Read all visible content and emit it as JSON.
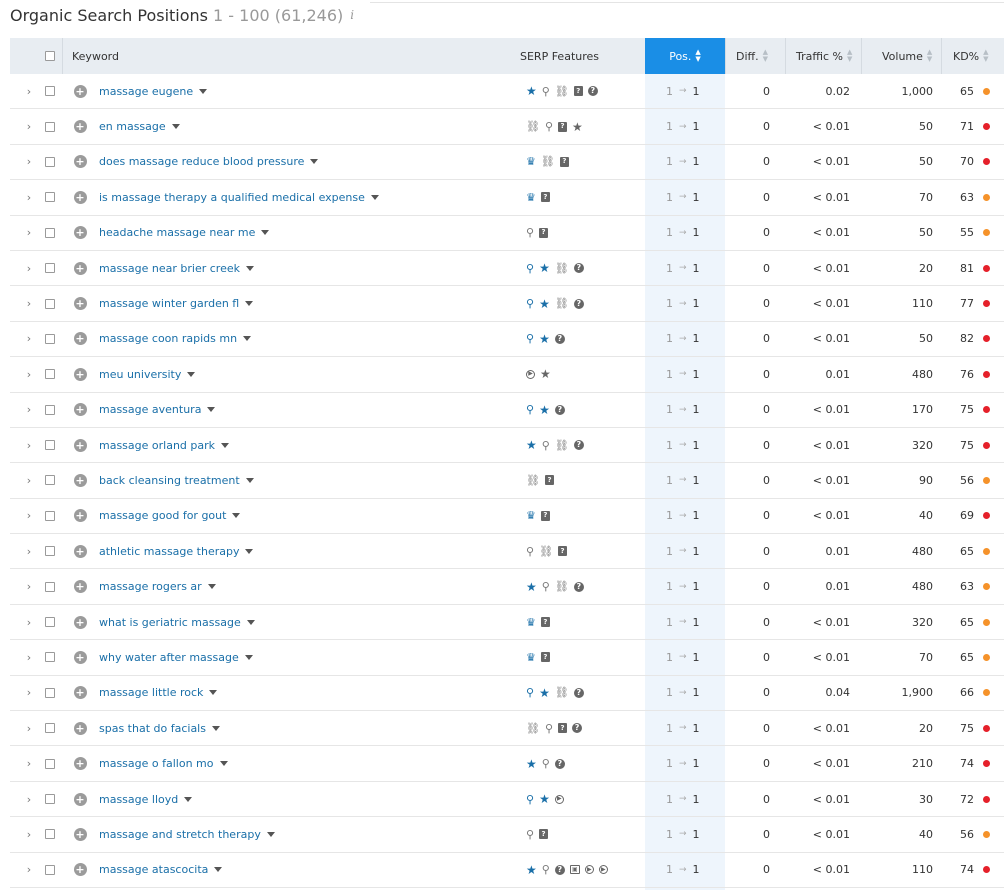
{
  "title": {
    "main": "Organic Search Positions",
    "range": "1 - 100 (61,246)",
    "info": "i"
  },
  "columns": {
    "keyword": "Keyword",
    "serp": "SERP Features",
    "pos": "Pos.",
    "diff": "Diff.",
    "traffic": "Traffic %",
    "volume": "Volume",
    "kd": "KD%"
  },
  "colors": {
    "link": "#1a6fa8",
    "accent": "#1a8ee6",
    "kd_orange": "#f5922a",
    "kd_red": "#e5202a"
  },
  "rows": [
    {
      "keyword": "massage eugene",
      "features": [
        "star",
        "pin",
        "link",
        "box",
        "question"
      ],
      "pos_from": "1",
      "pos_to": "1",
      "diff": "0",
      "traffic": "0.02",
      "volume": "1,000",
      "kd": "65",
      "kd_color": "orange"
    },
    {
      "keyword": "en massage",
      "features": [
        "link",
        "pin",
        "box",
        "gstar"
      ],
      "pos_from": "1",
      "pos_to": "1",
      "diff": "0",
      "traffic": "< 0.01",
      "volume": "50",
      "kd": "71",
      "kd_color": "red"
    },
    {
      "keyword": "does massage reduce blood pressure",
      "features": [
        "crown",
        "link",
        "box"
      ],
      "pos_from": "1",
      "pos_to": "1",
      "diff": "0",
      "traffic": "< 0.01",
      "volume": "50",
      "kd": "70",
      "kd_color": "red"
    },
    {
      "keyword": "is massage therapy a qualified medical expense",
      "features": [
        "crown",
        "box"
      ],
      "pos_from": "1",
      "pos_to": "1",
      "diff": "0",
      "traffic": "< 0.01",
      "volume": "70",
      "kd": "63",
      "kd_color": "orange"
    },
    {
      "keyword": "headache massage near me",
      "features": [
        "pin",
        "box"
      ],
      "pos_from": "1",
      "pos_to": "1",
      "diff": "0",
      "traffic": "< 0.01",
      "volume": "50",
      "kd": "55",
      "kd_color": "orange"
    },
    {
      "keyword": "massage near brier creek",
      "features": [
        "bpin",
        "star",
        "link",
        "question"
      ],
      "pos_from": "1",
      "pos_to": "1",
      "diff": "0",
      "traffic": "< 0.01",
      "volume": "20",
      "kd": "81",
      "kd_color": "red"
    },
    {
      "keyword": "massage winter garden fl",
      "features": [
        "bpin",
        "star",
        "link",
        "question"
      ],
      "pos_from": "1",
      "pos_to": "1",
      "diff": "0",
      "traffic": "< 0.01",
      "volume": "110",
      "kd": "77",
      "kd_color": "red"
    },
    {
      "keyword": "massage coon rapids mn",
      "features": [
        "bpin",
        "star",
        "question"
      ],
      "pos_from": "1",
      "pos_to": "1",
      "diff": "0",
      "traffic": "< 0.01",
      "volume": "50",
      "kd": "82",
      "kd_color": "red"
    },
    {
      "keyword": "meu university",
      "features": [
        "play",
        "gstar"
      ],
      "pos_from": "1",
      "pos_to": "1",
      "diff": "0",
      "traffic": "0.01",
      "volume": "480",
      "kd": "76",
      "kd_color": "red"
    },
    {
      "keyword": "massage aventura",
      "features": [
        "bpin",
        "star",
        "question"
      ],
      "pos_from": "1",
      "pos_to": "1",
      "diff": "0",
      "traffic": "< 0.01",
      "volume": "170",
      "kd": "75",
      "kd_color": "red"
    },
    {
      "keyword": "massage orland park",
      "features": [
        "star",
        "pin",
        "link",
        "question"
      ],
      "pos_from": "1",
      "pos_to": "1",
      "diff": "0",
      "traffic": "< 0.01",
      "volume": "320",
      "kd": "75",
      "kd_color": "red"
    },
    {
      "keyword": "back cleansing treatment",
      "features": [
        "link",
        "box"
      ],
      "pos_from": "1",
      "pos_to": "1",
      "diff": "0",
      "traffic": "< 0.01",
      "volume": "90",
      "kd": "56",
      "kd_color": "orange"
    },
    {
      "keyword": "massage good for gout",
      "features": [
        "crown",
        "box"
      ],
      "pos_from": "1",
      "pos_to": "1",
      "diff": "0",
      "traffic": "< 0.01",
      "volume": "40",
      "kd": "69",
      "kd_color": "red"
    },
    {
      "keyword": "athletic massage therapy",
      "features": [
        "pin",
        "link",
        "box"
      ],
      "pos_from": "1",
      "pos_to": "1",
      "diff": "0",
      "traffic": "0.01",
      "volume": "480",
      "kd": "65",
      "kd_color": "orange"
    },
    {
      "keyword": "massage rogers ar",
      "features": [
        "star",
        "pin",
        "link",
        "question"
      ],
      "pos_from": "1",
      "pos_to": "1",
      "diff": "0",
      "traffic": "0.01",
      "volume": "480",
      "kd": "63",
      "kd_color": "orange"
    },
    {
      "keyword": "what is geriatric massage",
      "features": [
        "crown",
        "box"
      ],
      "pos_from": "1",
      "pos_to": "1",
      "diff": "0",
      "traffic": "< 0.01",
      "volume": "320",
      "kd": "65",
      "kd_color": "orange"
    },
    {
      "keyword": "why water after massage",
      "features": [
        "crown",
        "box"
      ],
      "pos_from": "1",
      "pos_to": "1",
      "diff": "0",
      "traffic": "< 0.01",
      "volume": "70",
      "kd": "65",
      "kd_color": "orange"
    },
    {
      "keyword": "massage little rock",
      "features": [
        "bpin",
        "star",
        "link",
        "question"
      ],
      "pos_from": "1",
      "pos_to": "1",
      "diff": "0",
      "traffic": "0.04",
      "volume": "1,900",
      "kd": "66",
      "kd_color": "orange"
    },
    {
      "keyword": "spas that do facials",
      "features": [
        "link",
        "pin",
        "box",
        "question"
      ],
      "pos_from": "1",
      "pos_to": "1",
      "diff": "0",
      "traffic": "< 0.01",
      "volume": "20",
      "kd": "75",
      "kd_color": "red"
    },
    {
      "keyword": "massage o fallon mo",
      "features": [
        "star",
        "pin",
        "question"
      ],
      "pos_from": "1",
      "pos_to": "1",
      "diff": "0",
      "traffic": "< 0.01",
      "volume": "210",
      "kd": "74",
      "kd_color": "red"
    },
    {
      "keyword": "massage lloyd",
      "features": [
        "bpin",
        "star",
        "play"
      ],
      "pos_from": "1",
      "pos_to": "1",
      "diff": "0",
      "traffic": "< 0.01",
      "volume": "30",
      "kd": "72",
      "kd_color": "red"
    },
    {
      "keyword": "massage and stretch therapy",
      "features": [
        "pin",
        "box"
      ],
      "pos_from": "1",
      "pos_to": "1",
      "diff": "0",
      "traffic": "< 0.01",
      "volume": "40",
      "kd": "56",
      "kd_color": "orange"
    },
    {
      "keyword": "massage atascocita",
      "features": [
        "star",
        "pin",
        "question",
        "image",
        "play",
        "play"
      ],
      "pos_from": "1",
      "pos_to": "1",
      "diff": "0",
      "traffic": "< 0.01",
      "volume": "110",
      "kd": "74",
      "kd_color": "red"
    }
  ]
}
